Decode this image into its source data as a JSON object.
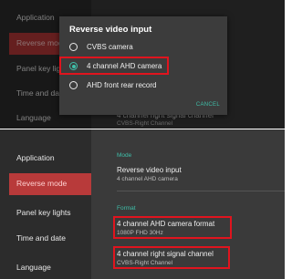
{
  "sidebar": {
    "items": [
      {
        "label": "Application"
      },
      {
        "label": "Reverse mode"
      },
      {
        "label": "Panel key lights"
      },
      {
        "label": "Time and date"
      },
      {
        "label": "Language"
      }
    ],
    "top_partial": [
      "Panel key light",
      "Time and dat"
    ]
  },
  "settings": {
    "mode_header": "Mode",
    "reverse_title": "Reverse video input",
    "reverse_value": "4 channel AHD camera",
    "format_header": "Format",
    "format_title": "4 channel AHD camera format",
    "format_value": "1080P FHD 30Hz",
    "channel_title": "4 channel right signal channel",
    "channel_value": "CVBS-Right Channel"
  },
  "dialog": {
    "title": "Reverse video input",
    "options": [
      {
        "label": "CVBS camera",
        "selected": false
      },
      {
        "label": "4 channel AHD camera",
        "selected": true
      },
      {
        "label": "AHD front rear record",
        "selected": false
      }
    ],
    "cancel_label": "CANCEL"
  },
  "colors": {
    "accent": "#3fbfa9",
    "selection": "#b83a3a",
    "highlight_box": "#e0141e"
  }
}
